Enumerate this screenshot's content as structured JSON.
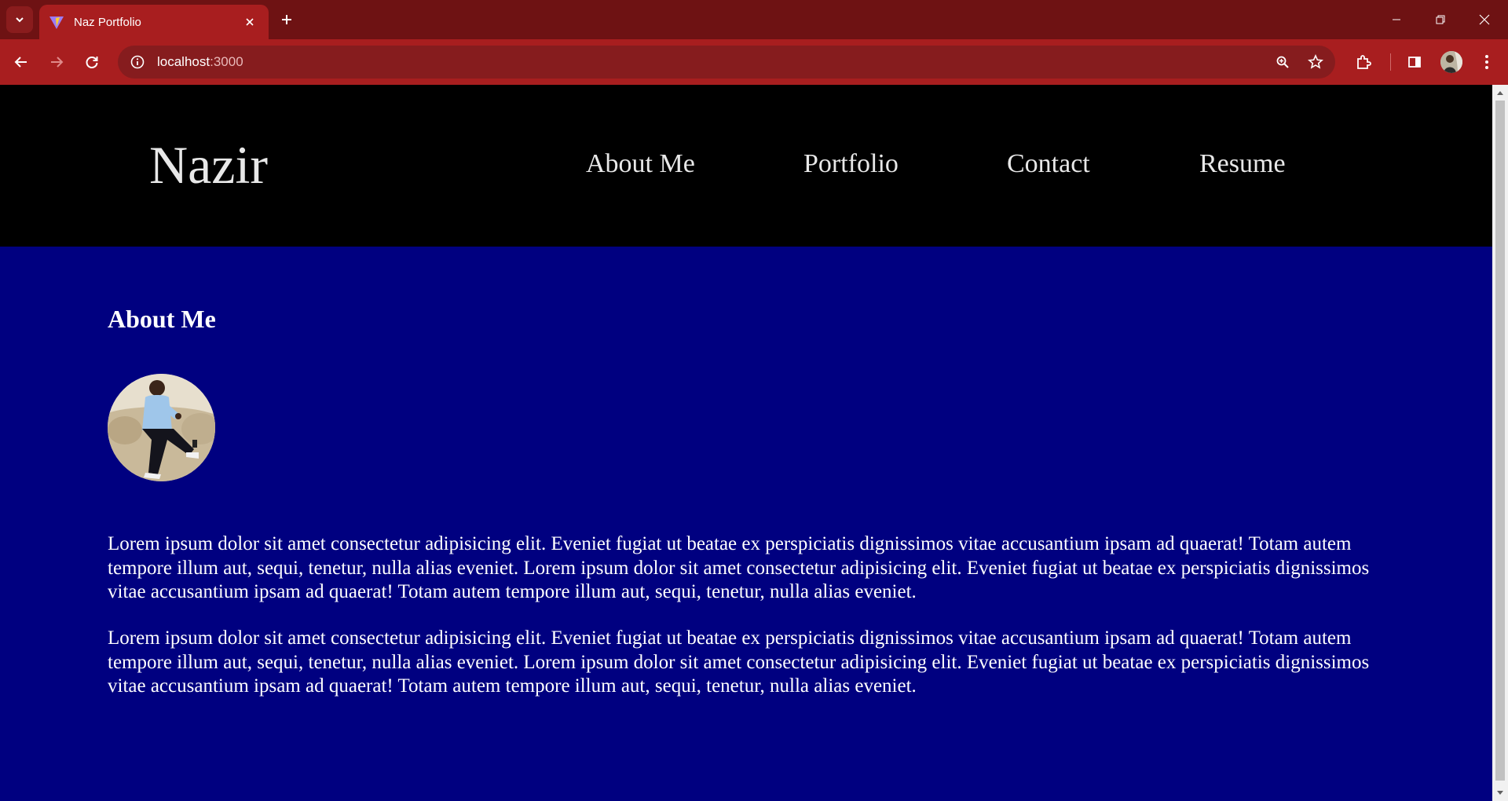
{
  "browser": {
    "tab_title": "Naz Portfolio",
    "url_host": "localhost",
    "url_port": ":3000"
  },
  "site": {
    "brand": "Nazir",
    "nav": [
      "About Me",
      "Portfolio",
      "Contact",
      "Resume"
    ]
  },
  "about": {
    "title": "About Me",
    "paragraphs": [
      "Lorem ipsum dolor sit amet consectetur adipisicing elit. Eveniet fugiat ut beatae ex perspiciatis dignissimos vitae accusantium ipsam ad quaerat! Totam autem tempore illum aut, sequi, tenetur, nulla alias eveniet. Lorem ipsum dolor sit amet consectetur adipisicing elit. Eveniet fugiat ut beatae ex perspiciatis dignissimos vitae accusantium ipsam ad quaerat! Totam autem tempore illum aut, sequi, tenetur, nulla alias eveniet.",
      "Lorem ipsum dolor sit amet consectetur adipisicing elit. Eveniet fugiat ut beatae ex perspiciatis dignissimos vitae accusantium ipsam ad quaerat! Totam autem tempore illum aut, sequi, tenetur, nulla alias eveniet. Lorem ipsum dolor sit amet consectetur adipisicing elit. Eveniet fugiat ut beatae ex perspiciatis dignissimos vitae accusantium ipsam ad quaerat! Totam autem tempore illum aut, sequi, tenetur, nulla alias eveniet."
    ]
  },
  "colors": {
    "chrome_tabstrip": "#6e1213",
    "chrome_toolbar": "#a81e1f",
    "header_bg": "#000000",
    "page_bg": "#000080",
    "text": "#ffffff"
  },
  "icons": {
    "tab_search": "chevron-down-icon",
    "favicon": "vite-logo-icon",
    "tab_close": "close-icon",
    "new_tab": "plus-icon",
    "minimize": "minimize-icon",
    "restore": "restore-icon",
    "close_window": "close-window-icon",
    "back": "arrow-left-icon",
    "forward": "arrow-right-icon",
    "reload": "reload-icon",
    "site_info": "info-icon",
    "zoom": "zoom-icon",
    "bookmark": "star-icon",
    "extensions": "puzzle-icon",
    "side_panel": "side-panel-icon",
    "profile": "avatar-icon",
    "menu": "kebab-menu-icon"
  }
}
